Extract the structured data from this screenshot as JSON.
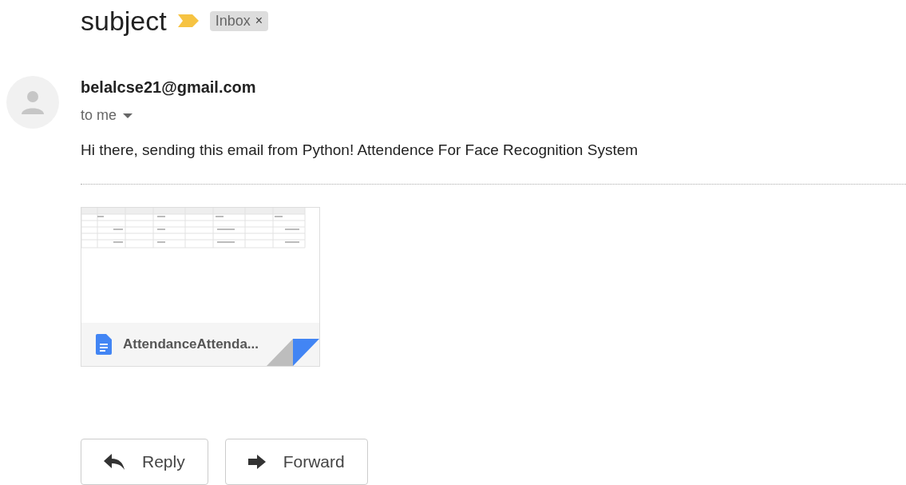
{
  "subject": "subject",
  "important": true,
  "labels": [
    {
      "text": "Inbox",
      "close": "×"
    }
  ],
  "sender": {
    "email": "belalcse21@gmail.com",
    "recipient": "to me"
  },
  "body": "Hi there, sending this email from Python! Attendence For Face Recognition System",
  "attachments": [
    {
      "name": "AttendanceAttenda..."
    }
  ],
  "actions": [
    {
      "kind": "reply",
      "label": "Reply"
    },
    {
      "kind": "forward",
      "label": "Forward"
    }
  ]
}
